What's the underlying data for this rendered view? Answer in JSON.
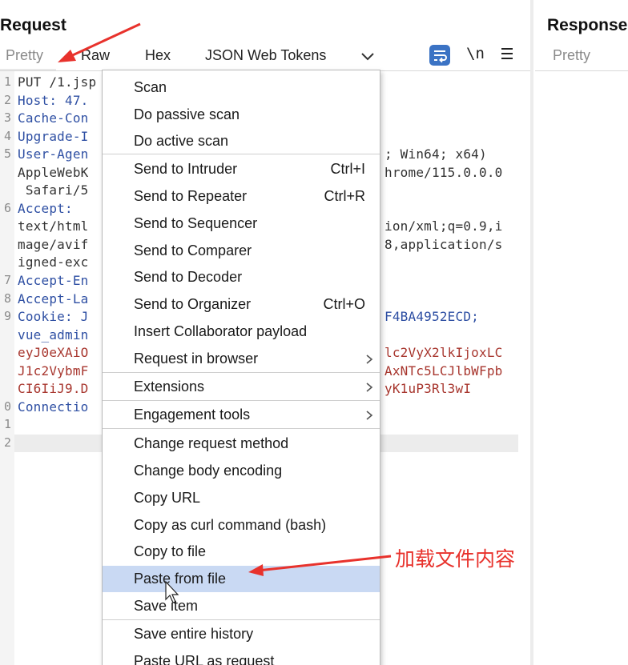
{
  "request": {
    "title": "Request",
    "tabs": [
      "Pretty",
      "Raw",
      "Hex",
      "JSON Web Tokens"
    ],
    "newline_toggle": "\\n",
    "icons": [
      "word-wrap-icon",
      "newline-icon",
      "hamburger-menu-icon",
      "chevron-down-icon"
    ]
  },
  "response": {
    "title": "Response",
    "tabs": [
      "Pretty"
    ]
  },
  "editor": {
    "line_numbers": [
      "1",
      "2",
      "3",
      "4",
      "5",
      "6",
      "7",
      "8",
      "9",
      "0",
      "1",
      "2"
    ],
    "lines": [
      {
        "left": "PUT /1.jsp",
        "right": ""
      },
      {
        "left": "Host: 47.",
        "right": ""
      },
      {
        "left": "Cache-Con",
        "right": ""
      },
      {
        "left": "Upgrade-I",
        "right": ""
      },
      {
        "left": "User-Agen",
        "right": "; Win64; x64)"
      },
      {
        "left": "AppleWebK",
        "right": "hrome/115.0.0.0"
      },
      {
        "left": " Safari/5",
        "right": ""
      },
      {
        "left": "Accept:",
        "right": ""
      },
      {
        "left": "text/html",
        "right": "ion/xml;q=0.9,i"
      },
      {
        "left": "mage/avif",
        "right": "8,application/s"
      },
      {
        "left": "igned-exc",
        "right": ""
      },
      {
        "left": "Accept-En",
        "right": ""
      },
      {
        "left": "Accept-La",
        "right": ""
      },
      {
        "left": "Cookie: J",
        "right": "F4BA4952ECD;"
      },
      {
        "left": "vue_admin",
        "right": ""
      },
      {
        "left": "eyJ0eXAiO",
        "right": "lc2VyX2lkIjoxLC"
      },
      {
        "left": "J1c2VybmF",
        "right": "AxNTc5LCJlbWFpb"
      },
      {
        "left": "CI6IiJ9.D",
        "right": "yK1uP3Rl3wI"
      },
      {
        "left": "Connectio",
        "right": ""
      }
    ]
  },
  "context_menu": {
    "items": [
      {
        "label": "Scan"
      },
      {
        "label": "Do passive scan"
      },
      {
        "label": "Do active scan"
      },
      {
        "label": "Send to Intruder",
        "shortcut": "Ctrl+I"
      },
      {
        "label": "Send to Repeater",
        "shortcut": "Ctrl+R"
      },
      {
        "label": "Send to Sequencer"
      },
      {
        "label": "Send to Comparer"
      },
      {
        "label": "Send to Decoder"
      },
      {
        "label": "Send to Organizer",
        "shortcut": "Ctrl+O"
      },
      {
        "label": "Insert Collaborator payload"
      },
      {
        "label": "Request in browser",
        "submenu": "›"
      },
      {
        "label": "Extensions",
        "submenu": "›"
      },
      {
        "label": "Engagement tools",
        "submenu": "›"
      },
      {
        "label": "Change request method"
      },
      {
        "label": "Change body encoding"
      },
      {
        "label": "Copy URL"
      },
      {
        "label": "Copy as curl command (bash)"
      },
      {
        "label": "Copy to file"
      },
      {
        "label": "Paste from file",
        "highlighted": true
      },
      {
        "label": "Save item"
      },
      {
        "label": "Save entire history"
      },
      {
        "label": "Paste URL as request"
      }
    ]
  },
  "annotation": {
    "text": "加载文件内容",
    "color": "#e8322c"
  },
  "colors": {
    "accent": "#3b73c4",
    "highlight": "#c9d9f3",
    "header_key": "#2e4fa3",
    "cookie_value": "#a8372f"
  }
}
